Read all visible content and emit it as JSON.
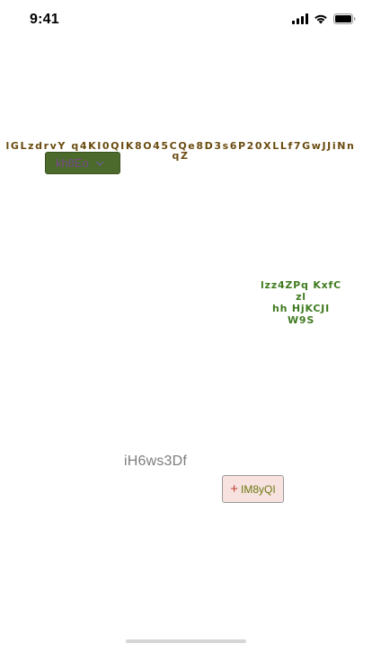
{
  "status_bar": {
    "time": "9:41",
    "icons": [
      "signal-icon",
      "wifi-icon",
      "battery-icon"
    ]
  },
  "headline": {
    "text": "lGLzdrvY q4KI0QIK8O45CQe8D3s6P20XLLf7GwJJiNnqZ",
    "color": "#6b4c10"
  },
  "dropdown": {
    "selected": "kh8Eo",
    "icon": "chevron-down-icon",
    "background": "#4b6a2c"
  },
  "green_block": {
    "lines": [
      "lzz4ZPq KxfC",
      "zl",
      "hh HjKCJI",
      "W9S"
    ],
    "color": "#3f7a1f"
  },
  "plain_label": {
    "text": "iH6ws3Df"
  },
  "add_button": {
    "icon": "plus-icon",
    "label": "IM8yQI",
    "background": "#f7e2df"
  }
}
